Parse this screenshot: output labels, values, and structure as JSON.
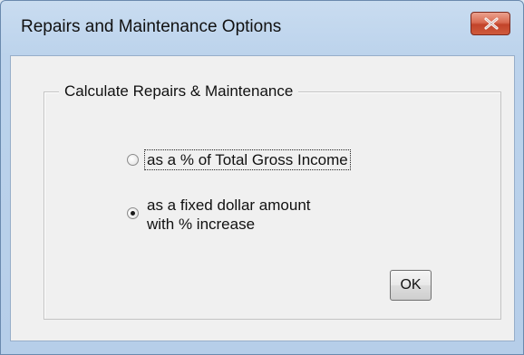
{
  "window": {
    "title": "Repairs and Maintenance Options"
  },
  "group": {
    "legend": "Calculate Repairs & Maintenance"
  },
  "options": [
    {
      "label": "as a % of Total Gross Income",
      "selected": false
    },
    {
      "label_line1": "as a fixed dollar amount",
      "label_line2": "with % increase",
      "selected": true
    }
  ],
  "buttons": {
    "ok_label": "OK"
  },
  "icons": {
    "close": "close-icon",
    "radio": "radio-button"
  },
  "colors": {
    "close_button": "#d35a3f",
    "title_bar": "#c3d8ee",
    "client_bg": "#f0f0f0"
  }
}
